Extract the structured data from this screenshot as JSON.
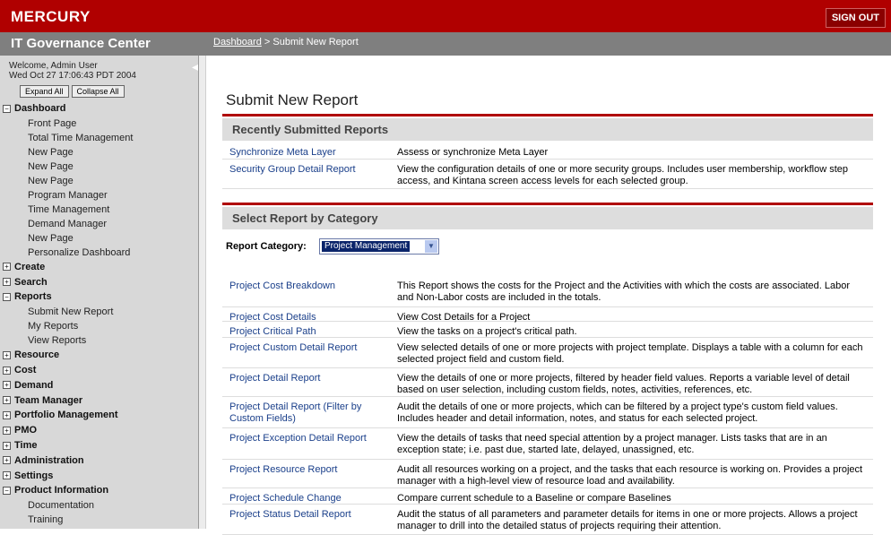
{
  "header": {
    "logo": "MERCURY",
    "sign_out": "SIGN OUT"
  },
  "subheader": {
    "app_title": "IT Governance Center",
    "breadcrumb_link": "Dashboard",
    "breadcrumb_sep": " > ",
    "breadcrumb_current": "Submit New Report"
  },
  "sidebar": {
    "welcome_line1": "Welcome, Admin User",
    "welcome_line2": "Wed Oct 27 17:06:43 PDT 2004",
    "expand_all": "Expand All",
    "collapse_all": "Collapse All",
    "nav": [
      {
        "type": "sec",
        "label": "Dashboard",
        "state": "open",
        "name": "nav-dashboard"
      },
      {
        "type": "item",
        "label": "Front Page",
        "name": "nav-front-page"
      },
      {
        "type": "item",
        "label": "Total Time Management",
        "name": "nav-total-time-management"
      },
      {
        "type": "item",
        "label": "New Page",
        "name": "nav-new-page-1"
      },
      {
        "type": "item",
        "label": "New Page",
        "name": "nav-new-page-2"
      },
      {
        "type": "item",
        "label": "New Page",
        "name": "nav-new-page-3"
      },
      {
        "type": "item",
        "label": "Program Manager",
        "name": "nav-program-manager"
      },
      {
        "type": "item",
        "label": "Time Management",
        "name": "nav-time-management"
      },
      {
        "type": "item",
        "label": "Demand Manager",
        "name": "nav-demand-manager"
      },
      {
        "type": "item",
        "label": "New Page",
        "name": "nav-new-page-4"
      },
      {
        "type": "item",
        "label": "Personalize Dashboard",
        "name": "nav-personalize-dashboard"
      },
      {
        "type": "sec",
        "label": "Create",
        "state": "closed",
        "name": "nav-create"
      },
      {
        "type": "sec",
        "label": "Search",
        "state": "closed",
        "name": "nav-search"
      },
      {
        "type": "sec",
        "label": "Reports",
        "state": "open",
        "name": "nav-reports"
      },
      {
        "type": "item",
        "label": "Submit New Report",
        "name": "nav-submit-new-report"
      },
      {
        "type": "item",
        "label": "My Reports",
        "name": "nav-my-reports"
      },
      {
        "type": "item",
        "label": "View Reports",
        "name": "nav-view-reports"
      },
      {
        "type": "sec",
        "label": "Resource",
        "state": "closed",
        "name": "nav-resource"
      },
      {
        "type": "sec",
        "label": "Cost",
        "state": "closed",
        "name": "nav-cost"
      },
      {
        "type": "sec",
        "label": "Demand",
        "state": "closed",
        "name": "nav-demand"
      },
      {
        "type": "sec",
        "label": "Team Manager",
        "state": "closed",
        "name": "nav-team-manager"
      },
      {
        "type": "sec",
        "label": "Portfolio Management",
        "state": "closed",
        "name": "nav-portfolio-management"
      },
      {
        "type": "sec",
        "label": "PMO",
        "state": "closed",
        "name": "nav-pmo"
      },
      {
        "type": "sec",
        "label": "Time",
        "state": "closed",
        "name": "nav-time"
      },
      {
        "type": "sec",
        "label": "Administration",
        "state": "closed",
        "name": "nav-administration"
      },
      {
        "type": "sec",
        "label": "Settings",
        "state": "closed",
        "name": "nav-settings"
      },
      {
        "type": "sec",
        "label": "Product Information",
        "state": "open",
        "name": "nav-product-information"
      },
      {
        "type": "item",
        "label": "Documentation",
        "name": "nav-documentation"
      },
      {
        "type": "item",
        "label": "Training",
        "name": "nav-training"
      }
    ]
  },
  "main": {
    "page_title": "Submit New Report",
    "recent_title": "Recently Submitted Reports",
    "recent": [
      {
        "name": "Synchronize Meta Layer",
        "desc": "Assess or synchronize Meta Layer"
      },
      {
        "name": "Security Group Detail Report",
        "desc": "View the configuration details of one or more security groups. Includes user membership, workflow step access, and Kintana screen access levels for each selected group."
      }
    ],
    "category_title": "Select Report by Category",
    "category_label": "Report Category:",
    "category_value": "Project Management",
    "reports": [
      {
        "name": "Project Cost Breakdown",
        "desc": "This Report shows the costs for the Project and the Activities with which the costs are associated. Labor and Non-Labor costs are included in the totals."
      },
      {
        "name": "Project Cost Details",
        "desc": "View Cost Details for a Project"
      },
      {
        "name": "Project Critical Path",
        "desc": "View the tasks on a project's critical path."
      },
      {
        "name": "Project Custom Detail Report",
        "desc": "View selected details of one or more projects with project template. Displays a table with a column for each selected project field and custom field."
      },
      {
        "name": "Project Detail Report",
        "desc": "View the details of one or more projects, filtered by header field values. Reports a variable level of detail based on user selection, including custom fields, notes, activities, references, etc."
      },
      {
        "name": "Project Detail Report (Filter by Custom Fields)",
        "desc": "Audit the details of one or more projects, which can be filtered by a project type's custom field values. Includes header and detail information, notes, and status for each selected project."
      },
      {
        "name": "Project Exception Detail Report",
        "desc": "View the details of tasks that need special attention by a project manager. Lists tasks that are in an exception state; i.e. past due, started late, delayed, unassigned, etc."
      },
      {
        "name": "Project Resource Report",
        "desc": "Audit all resources working on a project, and the tasks that each resource is working on. Provides a project manager with a high-level view of resource load and availability."
      },
      {
        "name": "Project Schedule Change",
        "desc": "Compare current schedule to a Baseline or compare Baselines"
      },
      {
        "name": "Project Status Detail Report",
        "desc": "Audit the status of all parameters and parameter details for items in one or more projects. Allows a project manager to drill into the detailed status of projects requiring their attention."
      }
    ]
  }
}
